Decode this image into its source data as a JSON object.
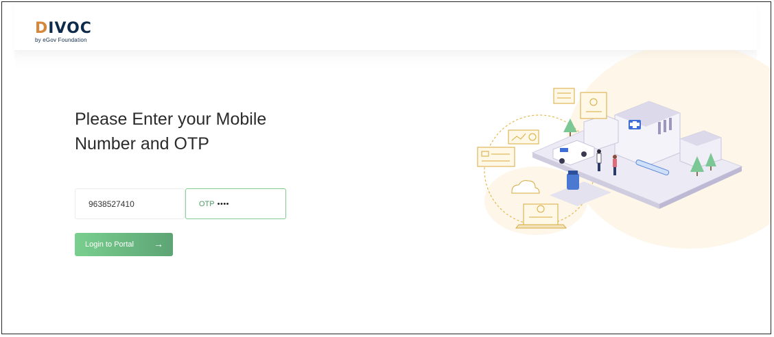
{
  "brand": {
    "logo_d": "D",
    "logo_i": "I",
    "logo_rest": "VOC",
    "tagline": "by eGov Foundation",
    "colors": {
      "orange": "#d6873b",
      "navy": "#0e2a4a",
      "green": "#6cbd83"
    }
  },
  "login": {
    "title": "Please Enter your Mobile Number and OTP",
    "mobile_value": "9638527410",
    "otp_placeholder": "OTP",
    "otp_masked": "••••",
    "button_label": "Login to Portal",
    "button_icon": "arrow-right-icon"
  },
  "illustration": {
    "name": "hospital-illustration"
  }
}
